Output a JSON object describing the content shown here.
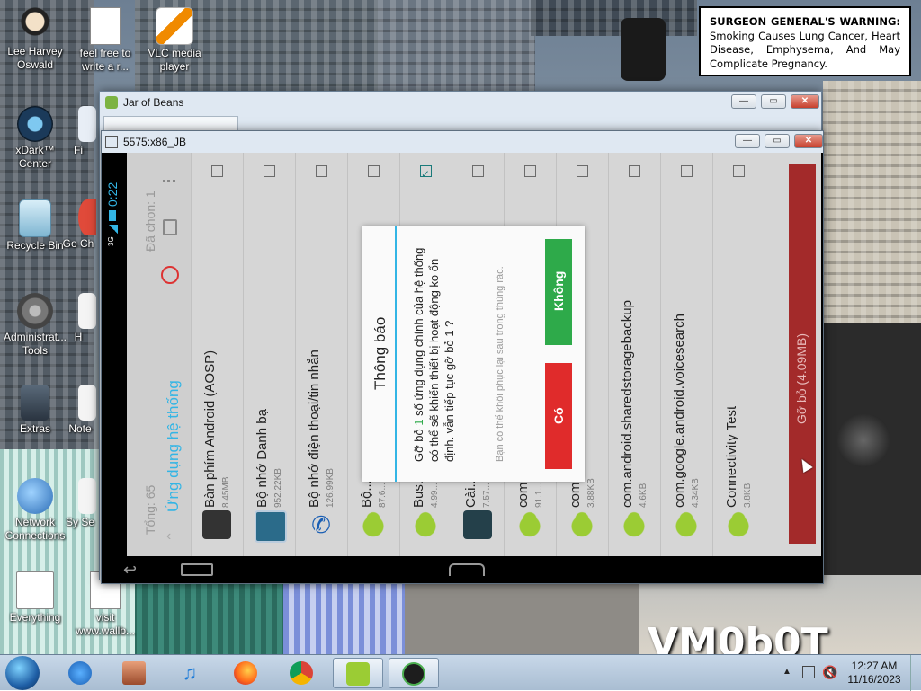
{
  "desktop": {
    "icons": [
      {
        "label": "Lee Harvey Oswald"
      },
      {
        "label": "feel free to write a r..."
      },
      {
        "label": "VLC media player"
      },
      {
        "label": "xDark™ Center"
      },
      {
        "label": "Fi"
      },
      {
        "label": "Recycle Bin"
      },
      {
        "label": "Go Ch"
      },
      {
        "label": "Administrat... Tools"
      },
      {
        "label": "H"
      },
      {
        "label": "Extras"
      },
      {
        "label": "Note"
      },
      {
        "label": "Network Connections"
      },
      {
        "label": "Sy Se"
      },
      {
        "label": "Everything"
      },
      {
        "label": "visit www.wallb..."
      }
    ],
    "warning": {
      "bold": "SURGEON GENERAL'S WARNING:",
      "text": "Smoking Causes Lung Cancer, Heart Disease, Emphysema, And May Complicate Pregnancy."
    },
    "wallpaper_text": "VM0b0T"
  },
  "outer_window": {
    "title": "Jar of Beans"
  },
  "emulator_window": {
    "title": "5575:x86_JB"
  },
  "android": {
    "status": {
      "time": "0:22",
      "network": "3G"
    },
    "header": {
      "title": "Ứng dụng hệ thống",
      "total": "Tổng: 65",
      "selected": "Đã chọn: 1"
    },
    "apps": [
      {
        "name": "Bàn phím Android (AOSP)",
        "size": "8.45MB",
        "icon": "keyboard-icon",
        "checked": false
      },
      {
        "name": "Bộ nhớ Danh bạ",
        "size": "952.22KB",
        "icon": "contacts-storage-icon",
        "checked": false
      },
      {
        "name": "Bộ nhớ điện thoại/tin nhắn",
        "size": "126.99KB",
        "icon": "phone-icon",
        "checked": false
      },
      {
        "name": "Bộ...",
        "size": "87.6...",
        "icon": "android-icon",
        "checked": false
      },
      {
        "name": "Bus...",
        "size": "4.99...",
        "icon": "android-icon",
        "checked": true
      },
      {
        "name": "Cài...",
        "size": "7.57...",
        "icon": "settings-icon",
        "checked": false
      },
      {
        "name": "com...",
        "size": "91.1...",
        "icon": "android-icon",
        "checked": false
      },
      {
        "name": "com...",
        "size": "3.88KB",
        "icon": "android-icon",
        "checked": false
      },
      {
        "name": "com.android.sharedstoragebackup",
        "size": "4.6KB",
        "icon": "android-icon",
        "checked": false
      },
      {
        "name": "com.google.android.voicesearch",
        "size": "4.34KB",
        "icon": "android-icon",
        "checked": false
      },
      {
        "name": "Connectivity Test",
        "size": "3.8KB",
        "icon": "android-icon",
        "checked": false
      }
    ],
    "uninstall_button": "Gỡ bỏ (4.09MB)",
    "dialog": {
      "title": "Thông báo",
      "message_pre": "Gỡ bỏ ",
      "message_count": "1",
      "message_post": " số ứng dụng chính của hệ thống có thể sẽ khiến thiết bị hoạt động ko ổn định. vẫn tiếp tục gỡ bỏ 1 ?",
      "note": "Bạn có thể khôi phục lại sau trong thùng rác.",
      "btn_no": "Không",
      "btn_yes": "Có"
    }
  },
  "taskbar": {
    "clock_time": "12:27 AM",
    "clock_date": "11/16/2023",
    "items": [
      "start",
      "ie",
      "media-center",
      "itunes",
      "firefox",
      "chrome",
      "android",
      "and-emulator"
    ]
  },
  "colors": {
    "accent": "#33b5e5",
    "yes": "#e02b2b",
    "no": "#2eaa4a",
    "uninstall": "#a32a2a"
  }
}
